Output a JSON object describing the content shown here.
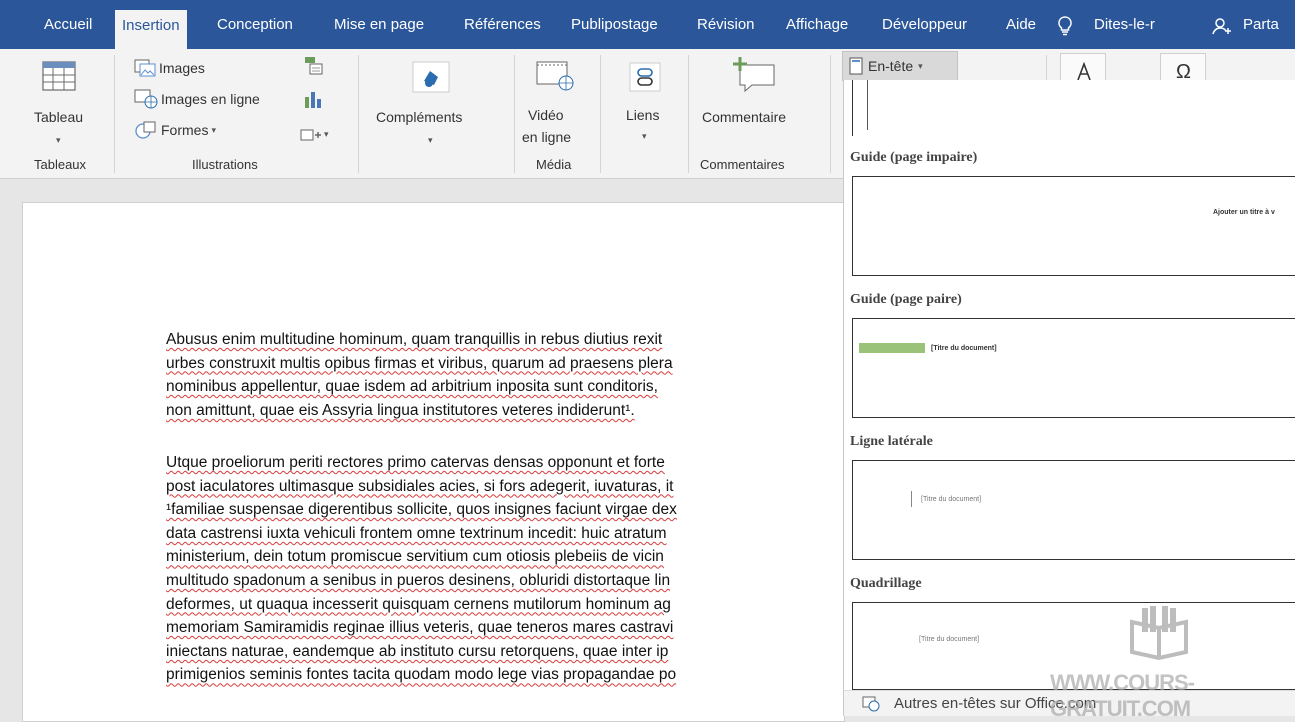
{
  "tabs": [
    {
      "label": "Accueil",
      "active": false
    },
    {
      "label": "Insertion",
      "active": true
    },
    {
      "label": "Conception",
      "active": false
    },
    {
      "label": "Mise en page",
      "active": false
    },
    {
      "label": "Références",
      "active": false
    },
    {
      "label": "Publipostage",
      "active": false
    },
    {
      "label": "Révision",
      "active": false
    },
    {
      "label": "Affichage",
      "active": false
    },
    {
      "label": "Développeur",
      "active": false
    },
    {
      "label": "Aide",
      "active": false
    },
    {
      "label": "Dites-le-r",
      "active": false
    },
    {
      "label": "Parta",
      "active": false
    }
  ],
  "ribbon": {
    "tableaux": {
      "button": "Tableau",
      "group": "Tableaux"
    },
    "illustrations": {
      "images": "Images",
      "images_en_ligne": "Images en ligne",
      "formes": "Formes",
      "group": "Illustrations"
    },
    "complements": {
      "button": "Compléments"
    },
    "media": {
      "button_line1": "Vidéo",
      "button_line2": "en ligne",
      "group": "Média"
    },
    "liens": {
      "button": "Liens"
    },
    "commentaires": {
      "button": "Commentaire",
      "group": "Commentaires"
    },
    "entete": {
      "button": "En-tête"
    }
  },
  "dropdown": {
    "sections": [
      {
        "title": "Guide (page impaire)",
        "sample": "Ajouter un titre à v"
      },
      {
        "title": "Guide (page paire)",
        "sample": "[Titre du document]"
      },
      {
        "title": "Ligne latérale",
        "sample": "[Titre du document]"
      },
      {
        "title": "Quadrillage",
        "sample": "[Titre du document]"
      }
    ],
    "footer": "Autres en-têtes sur Office.com"
  },
  "document": {
    "paragraph1": [
      "Abusus enim multitudine hominum, quam tranquillis in rebus diutius rexit",
      "urbes construxit multis opibus firmas et viribus, quarum ad praesens plera",
      "nominibus appellentur, quae isdem ad arbitrium inposita sunt conditoris,",
      "non amittunt, quae eis Assyria lingua institutores veteres indiderunt¹."
    ],
    "paragraph2": [
      "Utque proeliorum periti rectores primo catervas densas opponunt et forte",
      "post iaculatores ultimasque subsidiales acies, si fors adegerit, iuvaturas, it",
      "¹familiae suspensae digerentibus sollicite, quos insignes faciunt virgae dex",
      "data castrensi iuxta vehiculi frontem omne textrinum incedit: huic atratum",
      "ministerium, dein totum promiscue servitium cum otiosis plebeiis de vicin",
      "multitudo spadonum a senibus in pueros desinens, obluridi distortaque lin",
      "deformes, ut quaqua incesserit quisquam cernens mutilorum hominum ag",
      "memoriam Samiramidis reginae illius veteris, quae teneros mares castravi",
      "iniectans naturae, eandemque ab instituto cursu retorquens, quae inter ip",
      "primigenios seminis fontes tacita quodam modo lege vias propagandae po"
    ]
  },
  "watermark": "WWW.COURS-GRATUIT.COM",
  "colors": {
    "ribbon_blue": "#2b579a",
    "ribbon_bg": "#f3f3f3",
    "accent_green": "#9bc279"
  }
}
